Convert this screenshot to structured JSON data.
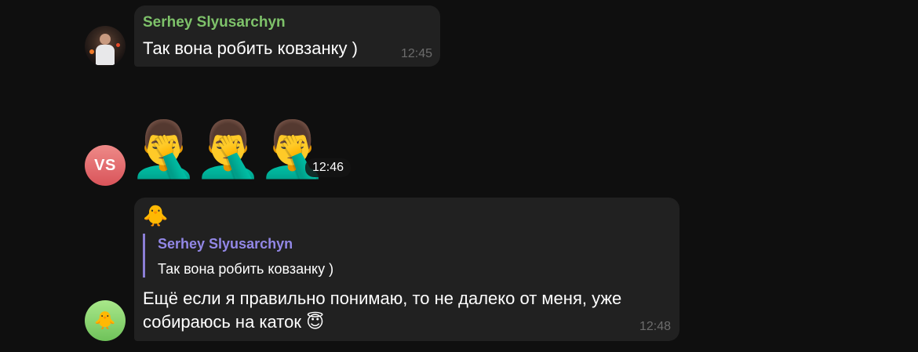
{
  "messages": [
    {
      "sender": "Serhey Slyusarchyn",
      "text": "Так вона робить ковзанку )",
      "time": "12:45",
      "avatar_icon": "user-photo-avatar",
      "sender_color": "#7ec26a"
    },
    {
      "avatar_initials": "VS",
      "emojis": [
        "🤦‍♂️",
        "🤦‍♂️",
        "🤦‍♂️"
      ],
      "time": "12:46"
    },
    {
      "top_emoji": "🐥",
      "avatar_emoji": "🐥",
      "reply": {
        "sender": "Serhey Slyusarchyn",
        "text": "Так вона робить ковзанку )"
      },
      "text": "Ещё если я правильно понимаю, то не далеко от меня, уже собираюсь на каток",
      "text_emoji": "😇",
      "time": "12:48"
    }
  ],
  "colors": {
    "background": "#0f0f0f",
    "bubble": "#212121",
    "reply_accent": "#8b7fd6",
    "vs_avatar": "#e06a6e",
    "chick_avatar": "#8fd672"
  }
}
